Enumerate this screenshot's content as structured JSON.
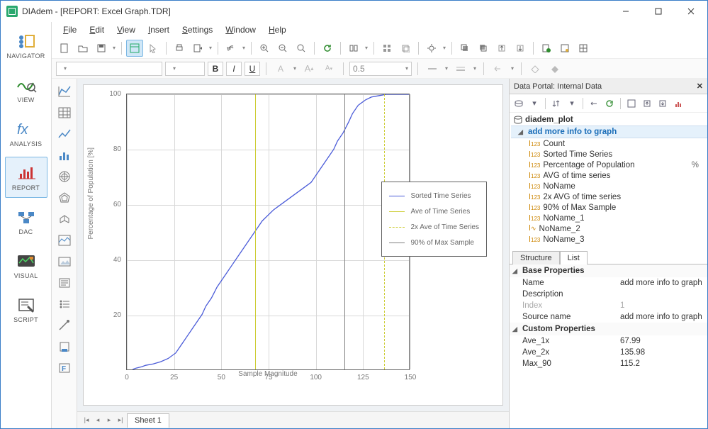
{
  "window": {
    "title": "DIAdem - [REPORT:   Excel Graph.TDR]"
  },
  "menu": {
    "items": [
      "File",
      "Edit",
      "View",
      "Insert",
      "Settings",
      "Window",
      "Help"
    ]
  },
  "nav": {
    "items": [
      {
        "label": "NAVIGATOR"
      },
      {
        "label": "VIEW"
      },
      {
        "label": "ANALYSIS"
      },
      {
        "label": "REPORT"
      },
      {
        "label": "DAC"
      },
      {
        "label": "VISUAL"
      },
      {
        "label": "SCRIPT"
      }
    ],
    "active_index": 3
  },
  "format": {
    "font_size": "0.5"
  },
  "sheet": {
    "tabs": [
      "Sheet 1"
    ],
    "active": 0
  },
  "legend": {
    "items": [
      {
        "label": "Sorted Time Series",
        "color": "#4a5bd8",
        "style": "solid"
      },
      {
        "label": "Ave of Time Series",
        "color": "#cccc33",
        "style": "solid"
      },
      {
        "label": "2x Ave of Time Series",
        "color": "#cccc33",
        "style": "dashed"
      },
      {
        "label": "90% of Max Sample",
        "color": "#808080",
        "style": "solid"
      }
    ]
  },
  "chart_data": {
    "type": "line",
    "title": "",
    "xlabel": "Sample Magnitude",
    "ylabel": "Percentage of Population [%]",
    "xlim": [
      0,
      150
    ],
    "ylim": [
      0,
      100
    ],
    "xticks": [
      0,
      25,
      50,
      75,
      100,
      125,
      150
    ],
    "yticks": [
      20,
      40,
      60,
      80,
      100
    ],
    "series": [
      {
        "name": "Sorted Time Series",
        "color": "#4a5bd8",
        "style": "solid",
        "x": [
          3,
          5,
          8,
          10,
          14,
          18,
          22,
          26,
          28,
          30,
          32,
          35,
          38,
          40,
          42,
          45,
          48,
          50,
          53,
          56,
          58,
          62,
          65,
          68,
          70,
          72,
          75,
          78,
          82,
          86,
          90,
          94,
          98,
          102,
          106,
          110,
          112,
          115,
          118,
          120,
          123,
          127,
          130,
          134,
          138,
          142,
          146,
          150
        ],
        "y": [
          0,
          0.5,
          1,
          1.5,
          2,
          2.8,
          4,
          6,
          8,
          10,
          12,
          15,
          18,
          20,
          23,
          26,
          30,
          32,
          35,
          38,
          40,
          44,
          47,
          50,
          52,
          54,
          56,
          58,
          60,
          62,
          64,
          66,
          68,
          72,
          76,
          80,
          83,
          86,
          90,
          93,
          96,
          98,
          99,
          99.5,
          100,
          100,
          100,
          100
        ]
      }
    ],
    "reference_lines": [
      {
        "name": "Ave of Time Series",
        "orientation": "v",
        "value": 67.99,
        "color": "#cccc33",
        "style": "solid"
      },
      {
        "name": "2x Ave of Time Series",
        "orientation": "v",
        "value": 135.98,
        "color": "#cccc33",
        "style": "dashed"
      },
      {
        "name": "90% of Max Sample",
        "orientation": "v",
        "value": 115.2,
        "color": "#808080",
        "style": "solid"
      }
    ]
  },
  "portal": {
    "title": "Data Portal: Internal Data",
    "root": "diadem_plot",
    "group": "add more info to graph",
    "channels": [
      {
        "name": "Count",
        "type": "num",
        "unit": ""
      },
      {
        "name": "Sorted Time Series",
        "type": "num",
        "unit": ""
      },
      {
        "name": "Percentage of Population",
        "type": "num",
        "unit": "%"
      },
      {
        "name": "AVG of time series",
        "type": "num",
        "unit": ""
      },
      {
        "name": "NoName",
        "type": "num",
        "unit": ""
      },
      {
        "name": "2x AVG of time series",
        "type": "num",
        "unit": ""
      },
      {
        "name": "90% of Max Sample",
        "type": "num",
        "unit": ""
      },
      {
        "name": "NoName_1",
        "type": "num",
        "unit": ""
      },
      {
        "name": "NoName_2",
        "type": "wave",
        "unit": ""
      },
      {
        "name": "NoName_3",
        "type": "num",
        "unit": ""
      }
    ]
  },
  "prop_tabs": {
    "items": [
      "Structure",
      "List"
    ],
    "active": 1
  },
  "props": {
    "base_title": "Base Properties",
    "custom_title": "Custom Properties",
    "base": [
      {
        "k": "Name",
        "v": "add more info to graph"
      },
      {
        "k": "Description",
        "v": ""
      },
      {
        "k": "Index",
        "v": "1",
        "disabled": true
      },
      {
        "k": "Source name",
        "v": "add more info to graph"
      }
    ],
    "custom": [
      {
        "k": "Ave_1x",
        "v": "67.99"
      },
      {
        "k": "Ave_2x",
        "v": "135.98"
      },
      {
        "k": "Max_90",
        "v": "115.2"
      }
    ]
  }
}
